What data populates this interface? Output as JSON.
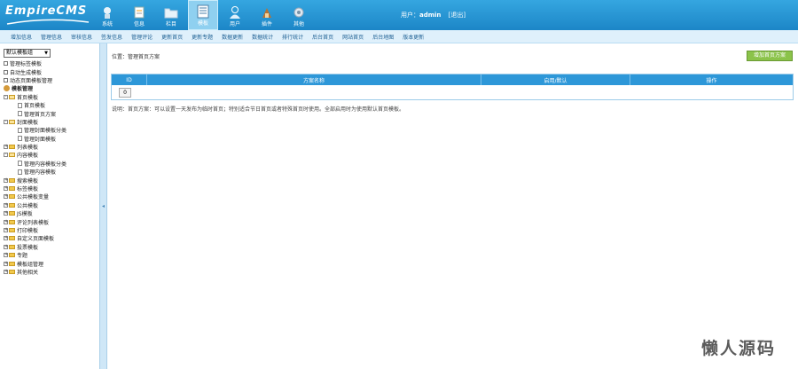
{
  "app": {
    "logo": "EmpireCMS"
  },
  "topnav": [
    {
      "label": "系统",
      "icon": "system-icon"
    },
    {
      "label": "信息",
      "icon": "info-icon"
    },
    {
      "label": "栏目",
      "icon": "folder-icon"
    },
    {
      "label": "模板",
      "icon": "template-icon",
      "active": true
    },
    {
      "label": "用户",
      "icon": "user-icon"
    },
    {
      "label": "插件",
      "icon": "plugin-icon"
    },
    {
      "label": "其他",
      "icon": "gear-icon"
    }
  ],
  "userbar": {
    "prefix": "用户：",
    "username": "admin",
    "logout": "[退出]"
  },
  "subnav": [
    "增加信息",
    "管理信息",
    "审核信息",
    "签发信息",
    "管理评论",
    "更新首页",
    "更新专题",
    "数据更新",
    "数据统计",
    "排行统计",
    "后台首页",
    "网站首页",
    "后台地图",
    "版本更新"
  ],
  "sidebar": {
    "select_value": "默认模板组",
    "items": [
      {
        "label": "管理标签模板",
        "type": "box",
        "level": 0
      },
      {
        "label": "自动生成模板",
        "type": "box",
        "level": 0
      },
      {
        "label": "动态页面模板管理",
        "type": "box",
        "level": 0
      },
      {
        "label": "模板管理",
        "type": "cog",
        "level": 0
      },
      {
        "label": "首页模板",
        "type": "folder-open",
        "level": 0,
        "pm": "-"
      },
      {
        "label": "首页模板",
        "type": "doc",
        "level": 1
      },
      {
        "label": "管理首页方案",
        "type": "doc",
        "level": 1
      },
      {
        "label": "封面模板",
        "type": "folder-open",
        "level": 0,
        "pm": "-"
      },
      {
        "label": "管理封面模板分类",
        "type": "doc",
        "level": 1
      },
      {
        "label": "管理封面模板",
        "type": "doc",
        "level": 1
      },
      {
        "label": "列表模板",
        "type": "folder",
        "level": 0,
        "pm": "+"
      },
      {
        "label": "内容模板",
        "type": "folder-open",
        "level": 0,
        "pm": "-"
      },
      {
        "label": "管理内容模板分类",
        "type": "doc",
        "level": 1
      },
      {
        "label": "管理内容模板",
        "type": "doc",
        "level": 1
      },
      {
        "label": "搜索模板",
        "type": "folder",
        "level": 0,
        "pm": "+"
      },
      {
        "label": "标签模板",
        "type": "folder",
        "level": 0,
        "pm": "+"
      },
      {
        "label": "公共模板变量",
        "type": "folder",
        "level": 0,
        "pm": "+"
      },
      {
        "label": "公共模板",
        "type": "folder",
        "level": 0,
        "pm": "+"
      },
      {
        "label": "JS模板",
        "type": "folder",
        "level": 0,
        "pm": "+"
      },
      {
        "label": "评论列表模板",
        "type": "folder",
        "level": 0,
        "pm": "+"
      },
      {
        "label": "打印模板",
        "type": "folder",
        "level": 0,
        "pm": "+"
      },
      {
        "label": "自定义页面模板",
        "type": "folder",
        "level": 0,
        "pm": "+"
      },
      {
        "label": "投票模板",
        "type": "folder",
        "level": 0,
        "pm": "+"
      },
      {
        "label": "专题",
        "type": "folder",
        "level": 0,
        "pm": "+"
      },
      {
        "label": "模板组管理",
        "type": "folder",
        "level": 0,
        "pm": "+"
      },
      {
        "label": "其他相关",
        "type": "folder",
        "level": 0,
        "pm": "+"
      }
    ]
  },
  "main": {
    "breadcrumb": "位置：管理首页方案",
    "add_button": "增加首页方案",
    "table": {
      "headers": [
        "ID",
        "方案名称",
        "启用/默认",
        "操作"
      ],
      "submit_label": "0"
    },
    "note": "说明：首页方案：可以设置一天发布为临时首页；特别适合节日首页或者特殊首页时使用。全部启用时为使用默认首页模板。"
  },
  "watermark": "懒人源码",
  "colors": {
    "header": "#1c86c7",
    "subnav": "#dff0fb",
    "table_head": "#2d97d8",
    "add_button": "#8bc34a"
  }
}
